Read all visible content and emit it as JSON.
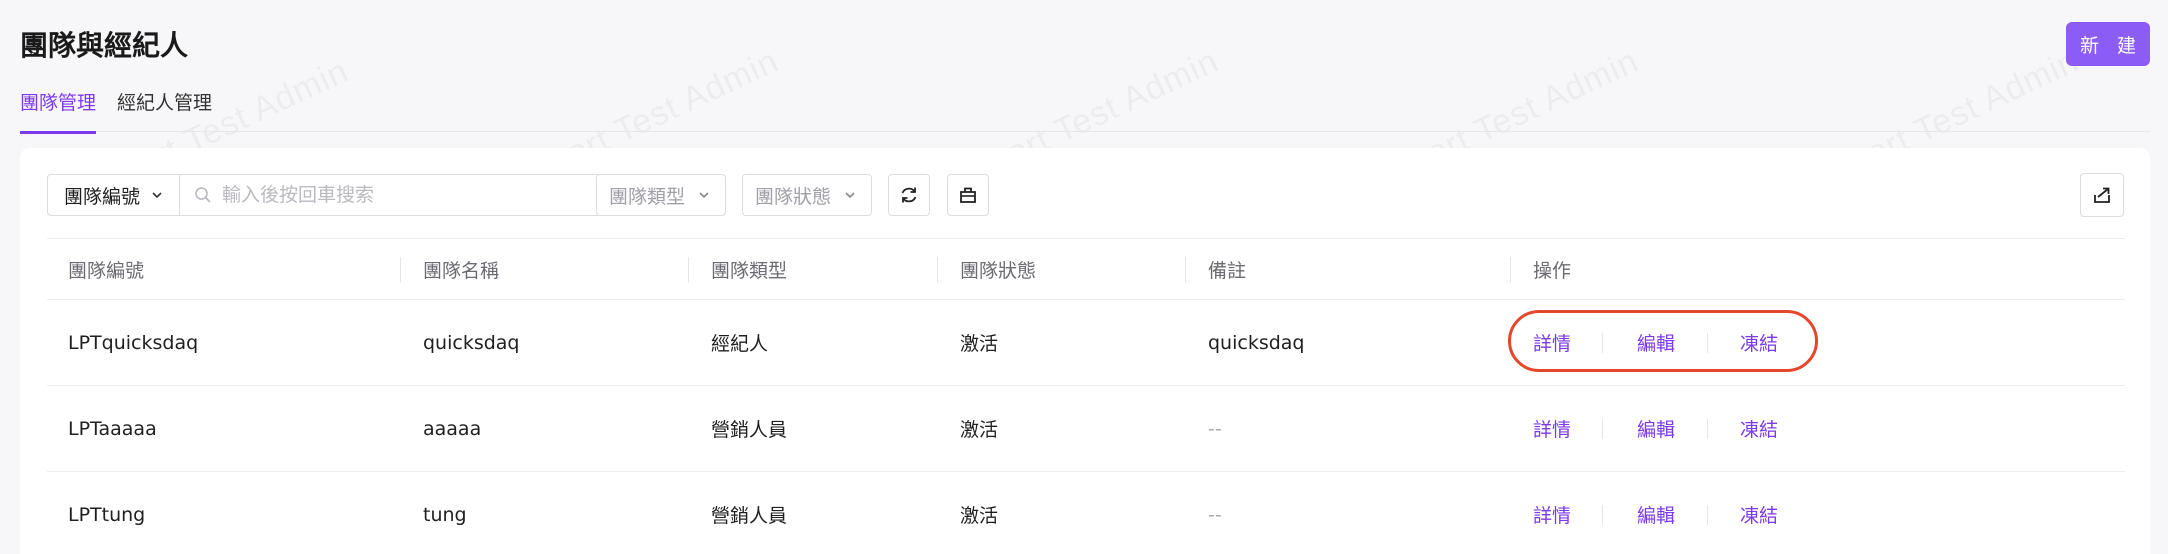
{
  "page": {
    "title": "團隊與經紀人",
    "new_button": "新 建"
  },
  "tabs": [
    {
      "label": "團隊管理",
      "active": true
    },
    {
      "label": "經紀人管理",
      "active": false
    }
  ],
  "filters": {
    "field_select": "團隊編號",
    "search_placeholder": "輸入後按回車搜索",
    "team_type_placeholder": "團隊類型",
    "team_status_placeholder": "團隊狀態"
  },
  "table": {
    "headers": [
      "團隊編號",
      "團隊名稱",
      "團隊類型",
      "團隊狀態",
      "備註",
      "操作"
    ],
    "rows": [
      {
        "code": "LPTquicksdaq",
        "name": "quicksdaq",
        "type": "經紀人",
        "status": "激活",
        "remark": "quicksdaq"
      },
      {
        "code": "LPTaaaaa",
        "name": "aaaaa",
        "type": "營銷人員",
        "status": "激活",
        "remark": "--"
      },
      {
        "code": "LPTtung",
        "name": "tung",
        "type": "營銷人員",
        "status": "激活",
        "remark": "--"
      }
    ],
    "actions": {
      "detail": "詳情",
      "edit": "編輯",
      "freeze": "凍結"
    }
  },
  "watermark": "LongPort Test Admin",
  "colors": {
    "accent": "#8b5cf6",
    "tab_active": "#7c3aed",
    "annotation": "#e5472a"
  }
}
